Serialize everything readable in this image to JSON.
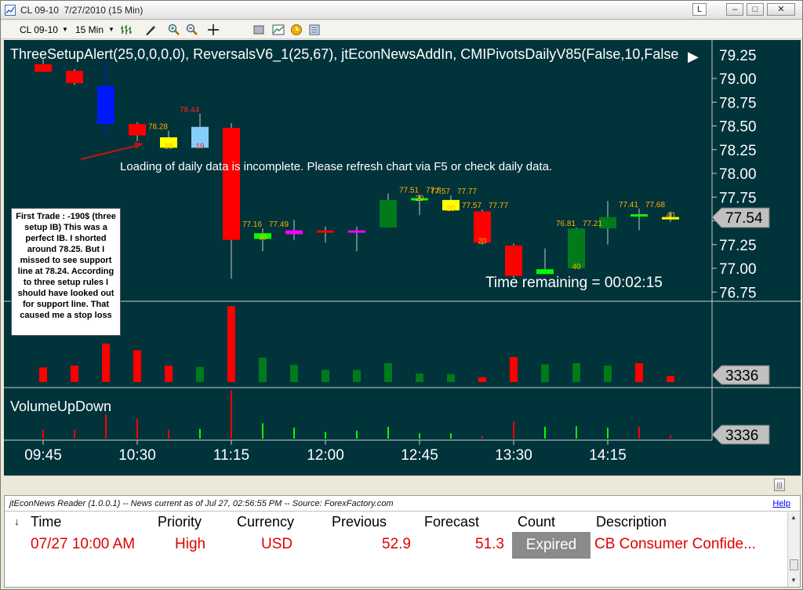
{
  "window": {
    "title": "CL 09-10  7/27/2010 (15 Min)",
    "controls": [
      "L",
      "–",
      "□",
      "✕"
    ]
  },
  "toolbar": {
    "instrument": "CL 09-10",
    "interval": "15 Min",
    "icons": [
      "bar-type-icon",
      "drawing-pen-icon",
      "zoom-in-icon",
      "zoom-out-icon",
      "crosshair-icon",
      "properties-icon",
      "chart-icon",
      "clock-icon",
      "data-box-icon"
    ]
  },
  "chart": {
    "indicators_label": "ThreeSetupAlert(25,0,0,0,0),   ReversalsV6_1(25,67),  jtEconNewsAddIn,   CMIPivotsDailyV85(False,10,False",
    "warning": "Loading of daily data is incomplete. Please refresh chart via F5 or check daily data.",
    "time_remaining": "Time remaining = 00:02:15",
    "volume_label": "VolumeUpDown",
    "price_marker": "77.54",
    "volume_marker_1": "3336",
    "volume_marker_2": "3336",
    "note": "First Trade : -190$ (three setup IB) This was a perfect IB. I shorted around 78.25. But I missed to see support line at 78.24. According to three setup rules I should have looked out for support line. That caused me a stop loss",
    "colors": {
      "bg": "#00333a",
      "up": "#007a1a",
      "down": "#ff0000",
      "text": "#ffffff",
      "label": "#ffb000"
    }
  },
  "chart_data": {
    "type": "candlestick",
    "price_axis_ticks": [
      "79.00",
      "78.75",
      "78.50",
      "78.25",
      "78.00",
      "77.75",
      "77.50",
      "77.25",
      "77.00",
      "76.75"
    ],
    "price_axis_ticks_partial": [
      "79.25"
    ],
    "time_axis_ticks": [
      "09:45",
      "10:30",
      "11:15",
      "12:00",
      "12:45",
      "13:30",
      "14:15"
    ],
    "candles": [
      {
        "o": 79.15,
        "h": 79.2,
        "l": 79.07,
        "c": 79.07,
        "color": "red"
      },
      {
        "o": 79.08,
        "h": 79.1,
        "l": 78.93,
        "c": 78.95,
        "color": "red"
      },
      {
        "o": 78.92,
        "h": 79.18,
        "l": 78.4,
        "c": 78.52,
        "color": "blue"
      },
      {
        "o": 78.52,
        "h": 78.54,
        "l": 78.34,
        "c": 78.4,
        "color": "red"
      },
      {
        "o": 78.38,
        "h": 78.45,
        "l": 78.28,
        "c": 78.27,
        "color": "yellow"
      },
      {
        "o": 78.49,
        "h": 78.63,
        "l": 78.27,
        "c": 78.27,
        "color": "lightblue"
      },
      {
        "o": 78.48,
        "h": 78.53,
        "l": 76.89,
        "c": 77.3,
        "color": "red"
      },
      {
        "o": 77.31,
        "h": 77.42,
        "l": 77.18,
        "c": 77.37,
        "color": "lime"
      },
      {
        "o": 77.4,
        "h": 77.51,
        "l": 77.3,
        "c": 77.36,
        "color": "magenta"
      },
      {
        "o": 77.4,
        "h": 77.44,
        "l": 77.27,
        "c": 77.38,
        "color": "red"
      },
      {
        "o": 77.38,
        "h": 77.44,
        "l": 77.18,
        "c": 77.4,
        "color": "magenta"
      },
      {
        "o": 77.43,
        "h": 77.79,
        "l": 77.43,
        "c": 77.72,
        "color": "green"
      },
      {
        "o": 77.72,
        "h": 77.78,
        "l": 77.56,
        "c": 77.74,
        "color": "lime"
      },
      {
        "o": 77.72,
        "h": 77.77,
        "l": 77.61,
        "c": 77.61,
        "color": "yellow"
      },
      {
        "o": 77.6,
        "h": 77.62,
        "l": 77.25,
        "c": 77.27,
        "color": "red"
      },
      {
        "o": 77.24,
        "h": 77.26,
        "l": 76.9,
        "c": 76.92,
        "color": "red"
      },
      {
        "o": 76.99,
        "h": 77.21,
        "l": 76.94,
        "c": 76.94,
        "color": "lime"
      },
      {
        "o": 77.0,
        "h": 77.43,
        "l": 77.0,
        "c": 77.42,
        "color": "green"
      },
      {
        "o": 77.42,
        "h": 77.71,
        "l": 77.25,
        "c": 77.54,
        "color": "green"
      },
      {
        "o": 77.55,
        "h": 77.63,
        "l": 77.4,
        "c": 77.57,
        "color": "lime"
      },
      {
        "o": 77.54,
        "h": 77.6,
        "l": 77.49,
        "c": 77.54,
        "color": "yellow"
      }
    ],
    "candle_labels": [
      {
        "i": 4,
        "text": "78.28",
        "color": "#ffb000"
      },
      {
        "i": 4,
        "text": "18",
        "color": "#ffb000"
      },
      {
        "i": 5,
        "text": "78.44",
        "color": "#ff2020"
      },
      {
        "i": 5,
        "text": "19",
        "color": "#ff2020"
      },
      {
        "i": 7,
        "text": "77.16",
        "color": "#ffb000"
      },
      {
        "i": 7,
        "text": "77.49",
        "color": "#ffb000"
      },
      {
        "i": 7,
        "text": "30",
        "color": "#ffb000"
      },
      {
        "i": 12,
        "text": "77.51",
        "color": "#ffb000"
      },
      {
        "i": 12,
        "text": "77.8",
        "color": "#ffb000"
      },
      {
        "i": 12,
        "text": "29",
        "color": "#ffb000"
      },
      {
        "i": 13,
        "text": "77.57",
        "color": "#ffb000"
      },
      {
        "i": 13,
        "text": "77.77",
        "color": "#ffb000"
      },
      {
        "i": 13,
        "text": "20",
        "color": "#ffb000"
      },
      {
        "i": 14,
        "text": "77.57",
        "color": "#ffb000"
      },
      {
        "i": 14,
        "text": "77.77",
        "color": "#ffb000"
      },
      {
        "i": 14,
        "text": "20",
        "color": "#ffb000"
      },
      {
        "i": 17,
        "text": "76.81",
        "color": "#ffb000"
      },
      {
        "i": 17,
        "text": "77.21",
        "color": "#ffb000"
      },
      {
        "i": 17,
        "text": "40",
        "color": "#ffb000"
      },
      {
        "i": 19,
        "text": "77.41",
        "color": "#ffb000"
      },
      {
        "i": 19,
        "text": "77.68",
        "color": "#ffb000"
      },
      {
        "i": 20,
        "text": "40",
        "color": "#ffb000"
      }
    ],
    "volume": [
      {
        "v": 0.24,
        "color": "red"
      },
      {
        "v": 0.27,
        "color": "red"
      },
      {
        "v": 0.63,
        "color": "red"
      },
      {
        "v": 0.52,
        "color": "red"
      },
      {
        "v": 0.27,
        "color": "red"
      },
      {
        "v": 0.25,
        "color": "green"
      },
      {
        "v": 1.24,
        "color": "red"
      },
      {
        "v": 0.4,
        "color": "green"
      },
      {
        "v": 0.28,
        "color": "green"
      },
      {
        "v": 0.2,
        "color": "green"
      },
      {
        "v": 0.2,
        "color": "green"
      },
      {
        "v": 0.31,
        "color": "green"
      },
      {
        "v": 0.14,
        "color": "green"
      },
      {
        "v": 0.13,
        "color": "green"
      },
      {
        "v": 0.08,
        "color": "red"
      },
      {
        "v": 0.41,
        "color": "red"
      },
      {
        "v": 0.29,
        "color": "green"
      },
      {
        "v": 0.31,
        "color": "green"
      },
      {
        "v": 0.27,
        "color": "green"
      },
      {
        "v": 0.31,
        "color": "red"
      },
      {
        "v": 0.1,
        "color": "red"
      }
    ],
    "volume_updown": [
      {
        "v": 0.2,
        "color": "red"
      },
      {
        "v": 0.2,
        "color": "red"
      },
      {
        "v": 0.55,
        "color": "red"
      },
      {
        "v": 0.45,
        "color": "red"
      },
      {
        "v": 0.2,
        "color": "red"
      },
      {
        "v": 0.22,
        "color": "lime"
      },
      {
        "v": 1.1,
        "color": "red"
      },
      {
        "v": 0.35,
        "color": "lime"
      },
      {
        "v": 0.25,
        "color": "lime"
      },
      {
        "v": 0.15,
        "color": "lime"
      },
      {
        "v": 0.18,
        "color": "lime"
      },
      {
        "v": 0.27,
        "color": "lime"
      },
      {
        "v": 0.12,
        "color": "lime"
      },
      {
        "v": 0.12,
        "color": "lime"
      },
      {
        "v": 0.06,
        "color": "red"
      },
      {
        "v": 0.38,
        "color": "red"
      },
      {
        "v": 0.27,
        "color": "lime"
      },
      {
        "v": 0.28,
        "color": "lime"
      },
      {
        "v": 0.25,
        "color": "lime"
      },
      {
        "v": 0.28,
        "color": "red"
      },
      {
        "v": 0.08,
        "color": "red"
      }
    ]
  },
  "news": {
    "header": "jtEconNews Reader (1.0.0.1)  --  News current as of Jul 27, 02:56:55 PM  --  Source: ForexFactory.com",
    "help": "Help",
    "sort_icon": "↓",
    "columns": [
      "Time",
      "Priority",
      "Currency",
      "Previous",
      "Forecast",
      "Count",
      "Description"
    ],
    "rows": [
      {
        "time": "07/27 10:00 AM",
        "priority": "High",
        "currency": "USD",
        "previous": "52.9",
        "forecast": "51.3",
        "count": "Expired",
        "description": "CB Consumer Confide..."
      }
    ]
  }
}
